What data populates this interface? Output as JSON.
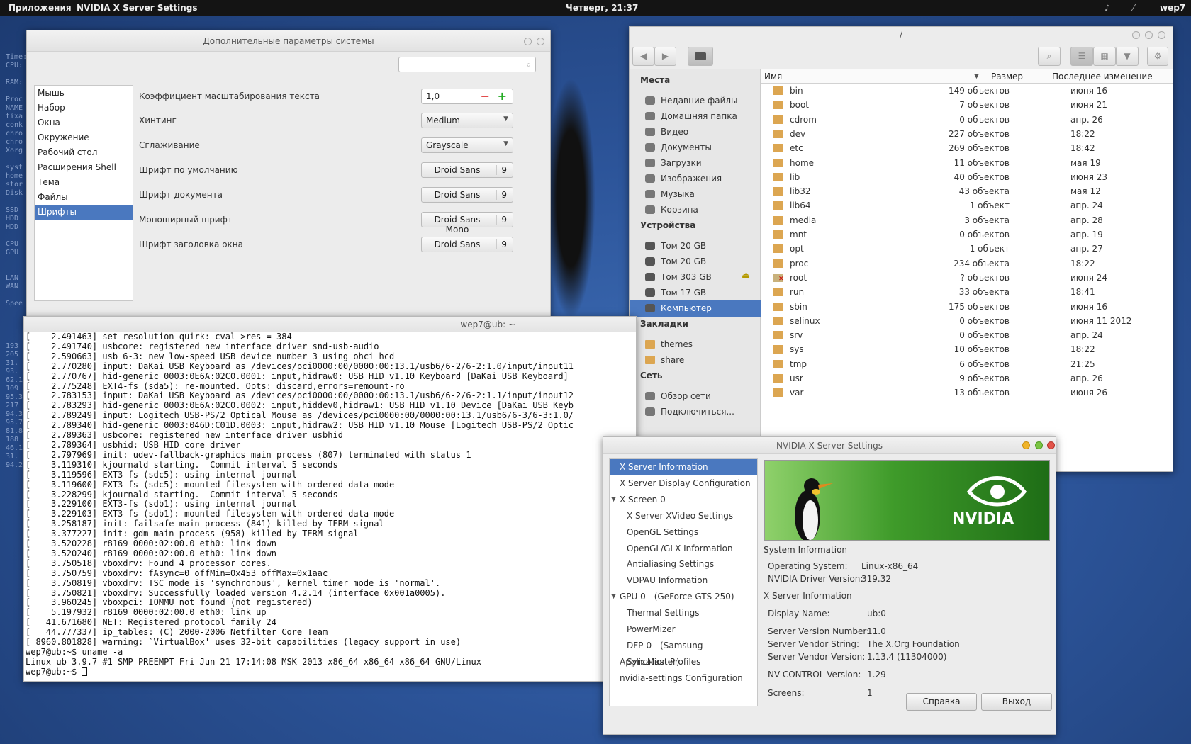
{
  "topbar": {
    "apps": "Приложения",
    "active_app": "NVIDIA X Server Settings",
    "clock": "Четверг, 21:37",
    "user": "wep7"
  },
  "conky": {
    "lines": "Time:\nCPU:\n\nRAM:\n\nProc\nNAME\ntixa\nconk\nchro\nchro\nXorg\n\nsyst\nhome\nstor\nDisk\n\nSSD\nHDD\nHDD\n\nCPU\nGPU\n\n\nLAN\nWAN\n\nSpee\n\n\n\n\n193\n205\n31.\n93.\n62.1\n109\n95.3\n217\n94.3\n95.7\n81.8\n188\n46.1\n31.\n94.2"
  },
  "settings": {
    "title": "Дополнительные параметры системы",
    "sidebar": [
      "Мышь",
      "Набор",
      "Окна",
      "Окружение",
      "Рабочий стол",
      "Расширения Shell",
      "Тема",
      "Файлы",
      "Шрифты"
    ],
    "scale_label": "Коэффициент масштабирования текста",
    "scale_value": "1,0",
    "hinting_label": "Хинтинг",
    "hinting_value": "Medium",
    "antialias_label": "Сглаживание",
    "antialias_value": "Grayscale",
    "default_font_label": "Шрифт по умолчанию",
    "default_font": "Droid Sans",
    "default_font_size": "9",
    "doc_font_label": "Шрифт документа",
    "doc_font": "Droid Sans",
    "doc_font_size": "9",
    "mono_font_label": "Моноширный шрифт",
    "mono_font": "Droid Sans Mono",
    "mono_font_size": "9",
    "title_font_label": "Шрифт заголовка окна",
    "title_font": "Droid Sans",
    "title_font_size": "9"
  },
  "terminal": {
    "title": "wep7@ub: ~",
    "lines": [
      "[    2.491463] set resolution quirk: cval->res = 384",
      "[    2.491740] usbcore: registered new interface driver snd-usb-audio",
      "[    2.590663] usb 6-3: new low-speed USB device number 3 using ohci_hcd",
      "[    2.770280] input: DaKai USB Keyboard as /devices/pci0000:00/0000:00:13.1/usb6/6-2/6-2:1.0/input/input11",
      "[    2.770767] hid-generic 0003:0E6A:02C0.0001: input,hidraw0: USB HID v1.10 Keyboard [DaKai USB Keyboard]",
      "[    2.775248] EXT4-fs (sda5): re-mounted. Opts: discard,errors=remount-ro",
      "[    2.783153] input: DaKai USB Keyboard as /devices/pci0000:00/0000:00:13.1/usb6/6-2/6-2:1.1/input/input12",
      "[    2.783293] hid-generic 0003:0E6A:02C0.0002: input,hiddev0,hidraw1: USB HID v1.10 Device [DaKai USB Keyb",
      "[    2.789249] input: Logitech USB-PS/2 Optical Mouse as /devices/pci0000:00/0000:00:13.1/usb6/6-3/6-3:1.0/",
      "[    2.789340] hid-generic 0003:046D:C01D.0003: input,hidraw2: USB HID v1.10 Mouse [Logitech USB-PS/2 Optic",
      "[    2.789363] usbcore: registered new interface driver usbhid",
      "[    2.789364] usbhid: USB HID core driver",
      "[    2.797969] init: udev-fallback-graphics main process (807) terminated with status 1",
      "[    3.119310] kjournald starting.  Commit interval 5 seconds",
      "[    3.119596] EXT3-fs (sdc5): using internal journal",
      "[    3.119600] EXT3-fs (sdc5): mounted filesystem with ordered data mode",
      "[    3.228299] kjournald starting.  Commit interval 5 seconds",
      "[    3.229100] EXT3-fs (sdb1): using internal journal",
      "[    3.229103] EXT3-fs (sdb1): mounted filesystem with ordered data mode",
      "[    3.258187] init: failsafe main process (841) killed by TERM signal",
      "[    3.377227] init: gdm main process (958) killed by TERM signal",
      "[    3.520228] r8169 0000:02:00.0 eth0: link down",
      "[    3.520240] r8169 0000:02:00.0 eth0: link down",
      "[    3.750518] vboxdrv: Found 4 processor cores.",
      "[    3.750759] vboxdrv: fAsync=0 offMin=0x453 offMax=0x1aac",
      "[    3.750819] vboxdrv: TSC mode is 'synchronous', kernel timer mode is 'normal'.",
      "[    3.750821] vboxdrv: Successfully loaded version 4.2.14 (interface 0x001a0005).",
      "[    3.960245] vboxpci: IOMMU not found (not registered)",
      "[    5.197932] r8169 0000:02:00.0 eth0: link up",
      "[   41.671680] NET: Registered protocol family 24",
      "[   44.777337] ip_tables: (C) 2000-2006 Netfilter Core Team",
      "[ 8960.801828] warning: `VirtualBox' uses 32-bit capabilities (legacy support in use)",
      "wep7@ub:~$ uname -a",
      "Linux ub 3.9.7 #1 SMP PREEMPT Fri Jun 21 17:14:08 MSK 2013 x86_64 x86_64 x86_64 GNU/Linux"
    ],
    "prompt": "wep7@ub:~$ "
  },
  "files": {
    "title": "/",
    "places_header": "Места",
    "places": [
      "Недавние файлы",
      "Домашняя папка",
      "Видео",
      "Документы",
      "Загрузки",
      "Изображения",
      "Музыка",
      "Корзина"
    ],
    "devices_header": "Устройства",
    "devices": [
      "Том 20 GB",
      "Том 20 GB",
      "Том 303 GB",
      "Том 17 GB",
      "Компьютер"
    ],
    "bookmarks_header": "Закладки",
    "bookmarks": [
      "themes",
      "share"
    ],
    "network_header": "Сеть",
    "network": [
      "Обзор сети",
      "Подключиться..."
    ],
    "col_name": "Имя",
    "col_size": "Размер",
    "col_modified": "Последнее изменение",
    "rows": [
      [
        "bin",
        "149 объектов",
        "июня 16"
      ],
      [
        "boot",
        "7 объектов",
        "июня 21"
      ],
      [
        "cdrom",
        "0 объектов",
        "апр. 26"
      ],
      [
        "dev",
        "227 объектов",
        "18:22"
      ],
      [
        "etc",
        "269 объектов",
        "18:42"
      ],
      [
        "home",
        "11 объектов",
        "мая 19"
      ],
      [
        "lib",
        "40 объектов",
        "июня 23"
      ],
      [
        "lib32",
        "43 объекта",
        "мая 12"
      ],
      [
        "lib64",
        "1 объект",
        "апр. 24"
      ],
      [
        "media",
        "3 объекта",
        "апр. 28"
      ],
      [
        "mnt",
        "0 объектов",
        "апр. 19"
      ],
      [
        "opt",
        "1 объект",
        "апр. 27"
      ],
      [
        "proc",
        "234 объекта",
        "18:22"
      ],
      [
        "root",
        "? объектов",
        "июня 24"
      ],
      [
        "run",
        "33 объекта",
        "18:41"
      ],
      [
        "sbin",
        "175 объектов",
        "июня 16"
      ],
      [
        "selinux",
        "0 объектов",
        "июня 11 2012"
      ],
      [
        "srv",
        "0 объектов",
        "апр. 24"
      ],
      [
        "sys",
        "10 объектов",
        "18:22"
      ],
      [
        "tmp",
        "6 объектов",
        "21:25"
      ],
      [
        "usr",
        "9 объектов",
        "апр. 26"
      ],
      [
        "var",
        "13 объектов",
        "июня 26"
      ]
    ]
  },
  "nvidia": {
    "title": "NVIDIA X Server Settings",
    "tree": [
      "X Server Information",
      "X Server Display Configuration",
      "X Screen 0",
      "X Server XVideo Settings",
      "OpenGL Settings",
      "OpenGL/GLX Information",
      "Antialiasing Settings",
      "VDPAU Information",
      "GPU 0 - (GeForce GTS 250)",
      "Thermal Settings",
      "PowerMizer",
      "DFP-0 - (Samsung SyncMaster)",
      "Application Profiles",
      "nvidia-settings Configuration"
    ],
    "logo": "NVIDIA",
    "sys_info_header": "System Information",
    "os_label": "Operating System:",
    "os_value": "Linux-x86_64",
    "driver_label": "NVIDIA Driver Version:",
    "driver_value": "319.32",
    "xinfo_header": "X Server Information",
    "display_label": "Display Name:",
    "display_value": "ub:0",
    "svn_label": "Server Version Number:",
    "svn_value": "11.0",
    "vendor_label": "Server Vendor String:",
    "vendor_value": "The X.Org Foundation",
    "vendorver_label": "Server Vendor Version:",
    "vendorver_value": "1.13.4 (11304000)",
    "nvctrl_label": "NV-CONTROL Version:",
    "nvctrl_value": "1.29",
    "screens_label": "Screens:",
    "screens_value": "1",
    "help_btn": "Справка",
    "quit_btn": "Выход"
  }
}
